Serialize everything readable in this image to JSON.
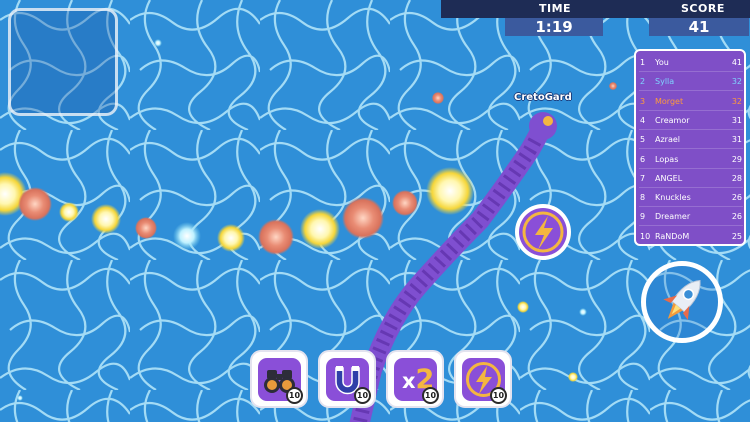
{
  "hud": {
    "time_label": "TIME",
    "time_value": "1:19",
    "score_label": "SCORE",
    "score_value": "41"
  },
  "leaderboard": [
    {
      "rank": "1",
      "name": "You",
      "score": "41",
      "color": "#ffffff"
    },
    {
      "rank": "2",
      "name": "Sylla",
      "score": "32",
      "color": "#7fd3ff"
    },
    {
      "rank": "3",
      "name": "Morget",
      "score": "32",
      "color": "#ff9a3c"
    },
    {
      "rank": "4",
      "name": "Creamor",
      "score": "31",
      "color": "#ffffff"
    },
    {
      "rank": "5",
      "name": "Azrael",
      "score": "31",
      "color": "#ffffff"
    },
    {
      "rank": "6",
      "name": "Lopas",
      "score": "29",
      "color": "#ffffff"
    },
    {
      "rank": "7",
      "name": "ANGEL",
      "score": "28",
      "color": "#ffffff"
    },
    {
      "rank": "8",
      "name": "Knuckles",
      "score": "26",
      "color": "#ffffff"
    },
    {
      "rank": "9",
      "name": "Dreamer",
      "score": "26",
      "color": "#ffffff"
    },
    {
      "rank": "10",
      "name": "RaNDoM",
      "score": "25",
      "color": "#ffffff"
    }
  ],
  "player": {
    "name": "CretoGard",
    "body_color": "#7f4fd0"
  },
  "powerups": [
    {
      "name": "binoculars",
      "icon": "binoculars-icon",
      "count": "10"
    },
    {
      "name": "magnet",
      "icon": "magnet-icon",
      "count": "10"
    },
    {
      "name": "double",
      "icon": "x2-icon",
      "count": "10",
      "label_x": "x",
      "label_2": "2"
    },
    {
      "name": "speed",
      "icon": "lightning-icon",
      "count": "10"
    }
  ],
  "colors": {
    "water": "#2f8fd8",
    "accent_purple": "#8a4fd8",
    "hud_dark": "#1e2c55",
    "hud_value": "#3b5a9e",
    "orb_yellow": "#f6e04a",
    "orb_orange": "#ee7a45"
  },
  "icons": {
    "boost": "rocket-icon",
    "pickup": "lightning-icon"
  }
}
